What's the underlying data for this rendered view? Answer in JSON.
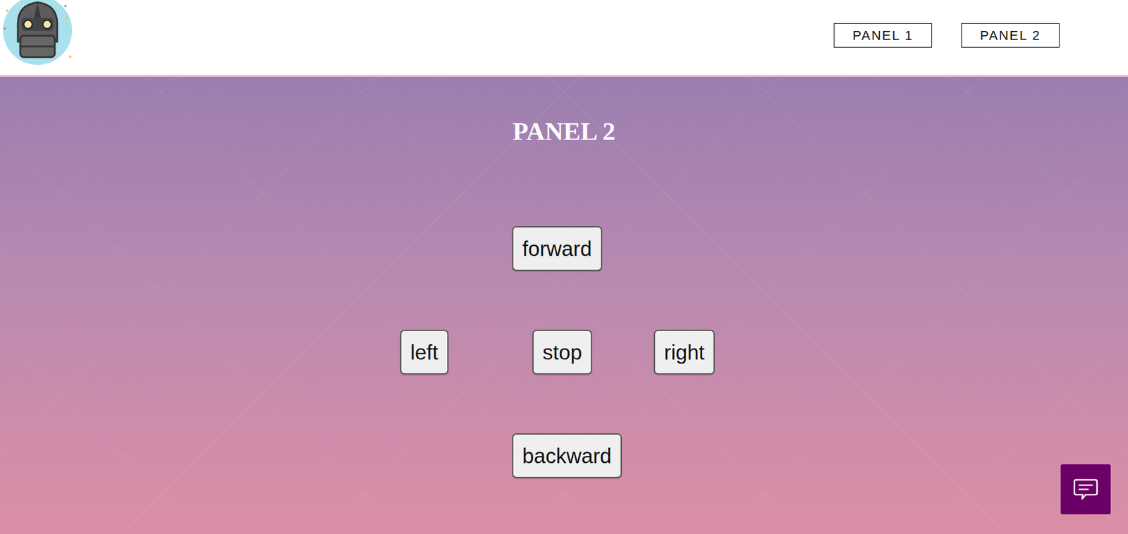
{
  "header": {
    "nav": [
      {
        "label": "PANEL 1"
      },
      {
        "label": "PANEL 2"
      }
    ]
  },
  "panel": {
    "title": "PANEL 2"
  },
  "controls": [
    {
      "label": "forward",
      "kind": "forward"
    },
    {
      "label": "left",
      "kind": "left"
    },
    {
      "label": "stop",
      "kind": "stop"
    },
    {
      "label": "right",
      "kind": "right"
    },
    {
      "label": "backward",
      "kind": "backward"
    }
  ]
}
